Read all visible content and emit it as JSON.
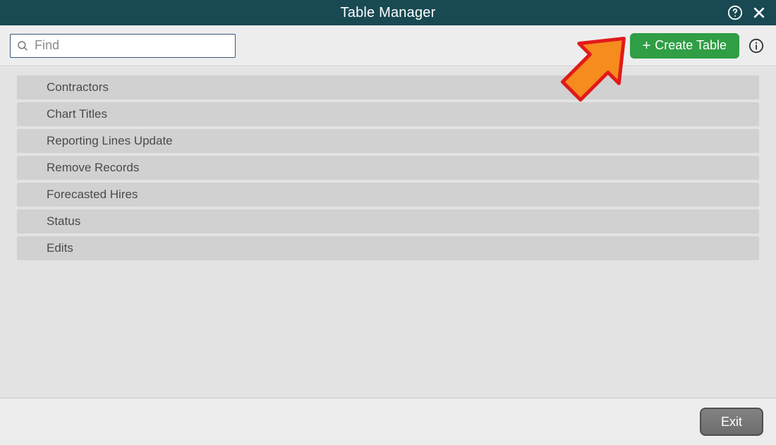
{
  "titlebar": {
    "title": "Table Manager"
  },
  "toolbar": {
    "search_placeholder": "Find",
    "create_label": "Create Table"
  },
  "list": {
    "items": [
      {
        "label": "Contractors"
      },
      {
        "label": "Chart Titles"
      },
      {
        "label": "Reporting Lines Update"
      },
      {
        "label": "Remove Records"
      },
      {
        "label": "Forecasted Hires"
      },
      {
        "label": "Status"
      },
      {
        "label": "Edits"
      }
    ]
  },
  "footer": {
    "exit_label": "Exit"
  },
  "colors": {
    "titlebar_bg": "#194953",
    "create_btn": "#2f9e44",
    "list_row": "#d1d1d1",
    "panel_bg": "#e3e3e3",
    "toolbar_bg": "#ededed",
    "arrow_fill": "#f68b1e",
    "arrow_stroke": "#e11a1a"
  },
  "icons": {
    "help": "help-circle-icon",
    "close": "close-icon",
    "search": "search-icon",
    "plus": "plus-icon",
    "info": "info-circle-icon"
  }
}
